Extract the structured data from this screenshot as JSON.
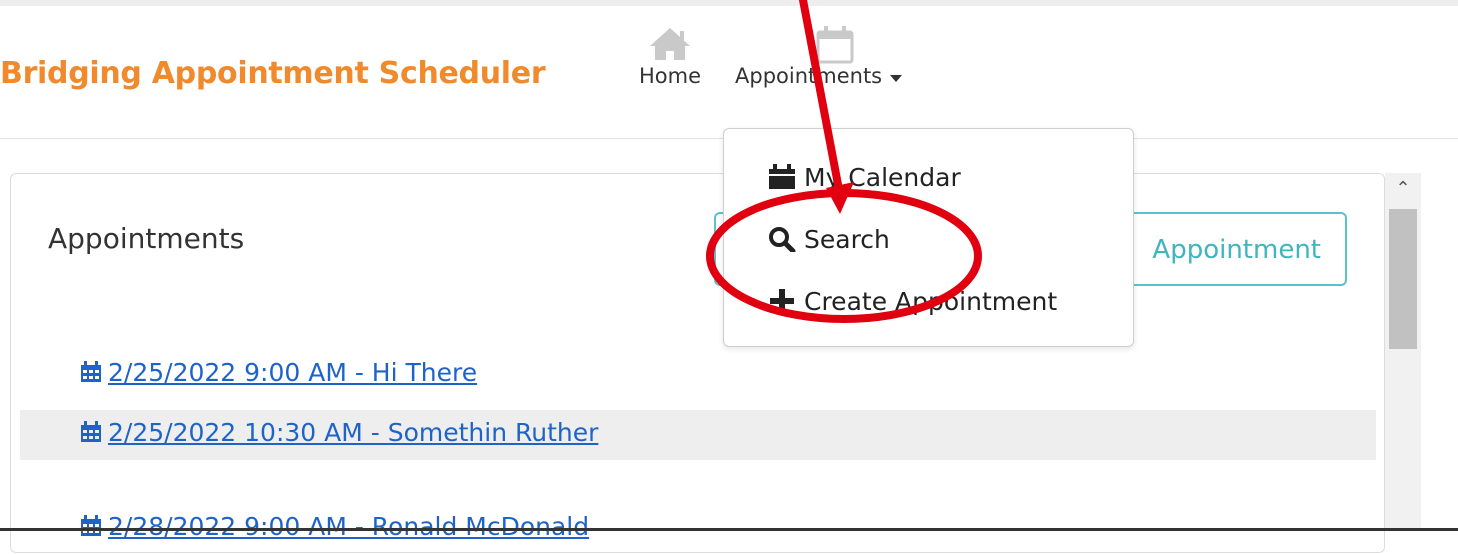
{
  "app": {
    "brand": "Bridging Appointment Scheduler"
  },
  "nav": {
    "home_label": "Home",
    "appointments_label": "Appointments"
  },
  "menu": {
    "items": [
      {
        "label": "My Calendar",
        "icon": "calendar-icon"
      },
      {
        "label": "Search",
        "icon": "search-icon"
      },
      {
        "label": "Create Appointment",
        "icon": "plus-icon"
      }
    ]
  },
  "card": {
    "title": "Appointments",
    "new_button_label": "Appointment"
  },
  "appointments": [
    "2/25/2022 9:00 AM - Hi There",
    "2/25/2022 10:30 AM - Somethin Ruther",
    "2/28/2022 9:00 AM - Ronald McDonald"
  ],
  "colors": {
    "brand": "#f08a2c",
    "link": "#1e63c8",
    "button_outline": "#58c3c9",
    "annotation": "#e0000f"
  }
}
